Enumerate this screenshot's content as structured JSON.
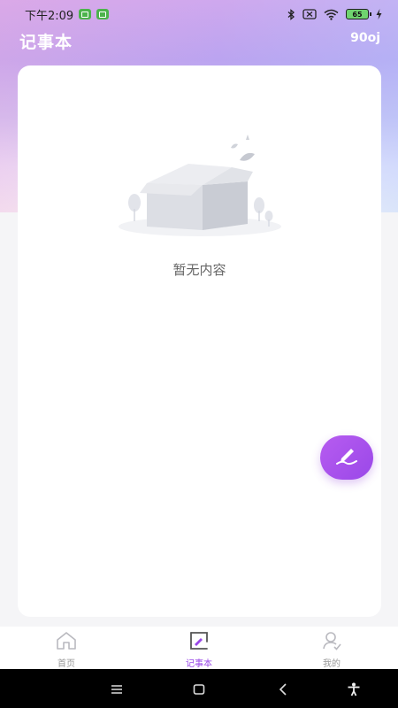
{
  "status_bar": {
    "time": "下午2:09",
    "battery_level": "65"
  },
  "header": {
    "title": "记事本",
    "code": "90oj"
  },
  "main": {
    "empty_text": "暂无内容"
  },
  "fab": {
    "icon": "edit-pen-icon",
    "color": "#a14fea"
  },
  "tabbar": {
    "tabs": [
      {
        "label": "首页",
        "icon": "home-icon",
        "active": false
      },
      {
        "label": "记事本",
        "icon": "notebook-icon",
        "active": true
      },
      {
        "label": "我的",
        "icon": "profile-icon",
        "active": false
      }
    ]
  },
  "nav": {
    "buttons": [
      "menu-icon",
      "home-square-icon",
      "back-icon",
      "accessibility-icon"
    ]
  },
  "colors": {
    "accent": "#9a48e8",
    "inactive": "#999999"
  }
}
